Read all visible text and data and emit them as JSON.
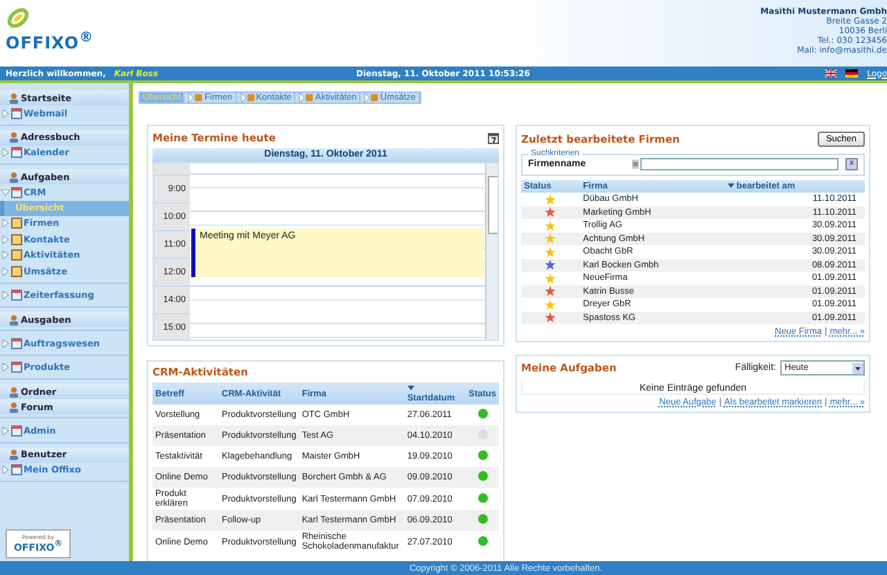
{
  "header": {
    "logo": "OFFIXO$^{®}$",
    "company": [
      "Masithi Mustermann Gmbh",
      "Breite Gasse 2",
      "10036 Berli",
      "Tel.: 030 123456",
      "Mail: info@masithi.de"
    ]
  },
  "top_bar": {
    "greeting": "Herzlich willkommen,",
    "user": "Karl Boss",
    "datetime": "Dienstag, 11. Oktober 2011 10:53:26",
    "logout": "Logo"
  },
  "sidebar": {
    "groups": [
      [
        {
          "label": "Startseite",
          "kind": "section"
        },
        {
          "label": "Webmail",
          "kind": "link",
          "expanded": false
        }
      ],
      [
        {
          "label": "Adressbuch",
          "kind": "section"
        },
        {
          "label": "Kalender",
          "kind": "link",
          "expanded": false
        }
      ],
      [
        {
          "label": "Aufgaben",
          "kind": "section"
        },
        {
          "label": "CRM",
          "kind": "link",
          "expanded": true,
          "children": [
            {
              "label": "Übersicht",
              "kind": "sub",
              "selected": true
            },
            {
              "label": "Firmen",
              "kind": "link",
              "expanded": false,
              "selected": false
            },
            {
              "label": "Kontakte",
              "kind": "link",
              "expanded": false,
              "selected": false
            },
            {
              "label": "Aktivitäten",
              "kind": "link",
              "expanded": false,
              "selected": false
            },
            {
              "label": "Umsätze",
              "kind": "link",
              "expanded": false,
              "selected": false
            }
          ]
        }
      ],
      [
        {
          "label": "Zeiterfassung",
          "kind": "link",
          "expanded": false
        }
      ],
      [
        {
          "label": "Ausgaben",
          "kind": "section"
        }
      ],
      [
        {
          "label": "Auftragswesen",
          "kind": "link",
          "expanded": false
        }
      ],
      [
        {
          "label": "Produkte",
          "kind": "link",
          "expanded": false
        }
      ],
      [
        {
          "label": "Ordner",
          "kind": "section"
        },
        {
          "label": "Forum",
          "kind": "section"
        }
      ],
      [
        {
          "label": "Admin",
          "kind": "link",
          "expanded": false
        }
      ],
      [
        {
          "label": "Benutzer",
          "kind": "section"
        },
        {
          "label": "Mein Offixo",
          "kind": "link",
          "expanded": false
        }
      ]
    ],
    "powered_by": {
      "caption": "Powered by",
      "logo": "OFFIXO$^{®}$"
    }
  },
  "tabs": [
    {
      "label": "Übersicht",
      "selected": true
    },
    {
      "label": "Firmen",
      "selected": false
    },
    {
      "label": "Kontakte",
      "selected": false
    },
    {
      "label": "Aktivitäten",
      "selected": false
    },
    {
      "label": "Umsätze",
      "selected": false
    }
  ],
  "appointments": {
    "title": "Meine Termine heute",
    "date": "Dienstag, 11. Oktober 2011",
    "hours": [
      {
        "label": "9:00"
      },
      {
        "label": "10:00"
      },
      {
        "label": "11:00",
        "event": "Meeting mit Meyer AG"
      },
      {
        "label": "12:00"
      },
      {
        "label": "14:00"
      },
      {
        "label": "15:00"
      }
    ]
  },
  "recent_companies": {
    "title": "Zuletzt bearbeitete Firmen",
    "search_button": "Suchen",
    "criteria_legend": "Suchkriterien",
    "field_label": "Firmenname",
    "clear_button": "x",
    "columns": [
      "Status",
      "Firma",
      "bearbeitet am"
    ],
    "rows": [
      {
        "color": "#f5c518",
        "name": "Dübau GmbH",
        "date": "11.10.2011"
      },
      {
        "color": "#e8584a",
        "name": "Marketing GmbH",
        "date": "11.10.2011"
      },
      {
        "color": "#f5c518",
        "name": "Trollig AG",
        "date": "30.09.2011"
      },
      {
        "color": "#f5c518",
        "name": "Achtung GmbH",
        "date": "30.09.2011"
      },
      {
        "color": "#f5c518",
        "name": "Obacht GbR",
        "date": "30.09.2011"
      },
      {
        "color": "#5a5ee0",
        "name": "Karl Bocken Gmbh",
        "date": "08.09.2011"
      },
      {
        "color": "#f5c518",
        "name": "NeueFirma",
        "date": "01.09.2011"
      },
      {
        "color": "#e8584a",
        "name": "Katrin Busse",
        "date": "01.09.2011"
      },
      {
        "color": "#f5c518",
        "name": "Dreyer GbR",
        "date": "01.09.2011"
      },
      {
        "color": "#e8584a",
        "name": "Spastoss KG",
        "date": "01.09.2011"
      }
    ],
    "links": [
      {
        "kind": "link",
        "text": "Neue Firma"
      },
      {
        "kind": "separator",
        "text": "|"
      },
      {
        "kind": "link",
        "text": "mehr... »"
      }
    ]
  },
  "crm_activities": {
    "title": "CRM-Aktivitäten",
    "columns": [
      "Betreff",
      "CRM-Aktivität",
      "Firma",
      "Startdatum",
      "Status"
    ],
    "rows": [
      {
        "subject": "Vorstellung",
        "activity": "Produktvorstellung",
        "company": "OTC GmbH",
        "start": "27.06.2011",
        "color": "#33bb22"
      },
      {
        "subject": "Präsentation",
        "activity": "Produktvorstellung",
        "company": "Test AG",
        "start": "04.10.2010",
        "color": "#dddddd"
      },
      {
        "subject": "Testaktivität",
        "activity": "Klagebehandlung",
        "company": "Maister GmbH",
        "start": "19.09.2010",
        "color": "#33bb22"
      },
      {
        "subject": "Online Demo",
        "activity": "Produktvorstellung",
        "company": "Borchert Gmbh & AG",
        "start": "09.09.2010",
        "color": "#33bb22"
      },
      {
        "subject": "Produkt erklären",
        "activity": "Produktvorstellung",
        "company": "Karl Testermann GmbH",
        "start": "07.09.2010",
        "color": "#33bb22"
      },
      {
        "subject": "Präsentation",
        "activity": "Follow-up",
        "company": "Karl Testermann GmbH",
        "start": "06.09.2010",
        "color": "#33bb22"
      },
      {
        "subject": "Online Demo",
        "activity": "Produktvorstellung",
        "company": "Rheinische Schokoladenmanufaktur",
        "start": "27.07.2010",
        "color": "#33bb22"
      }
    ]
  },
  "tasks": {
    "title": "Meine Aufgaben",
    "due_label": "Fälligkeit:",
    "due_value": "Heute",
    "empty": "Keine Einträge gefunden",
    "links": [
      {
        "kind": "link",
        "text": "Neue Aufgabe"
      },
      {
        "kind": "separator",
        "text": "|"
      },
      {
        "kind": "link",
        "text": "Als bearbeitet markieren"
      },
      {
        "kind": "separator",
        "text": "|"
      },
      {
        "kind": "link",
        "text": "mehr... »"
      }
    ]
  },
  "footer": "Copyright © 2006-2011 Alle Rechte vorbehalten."
}
